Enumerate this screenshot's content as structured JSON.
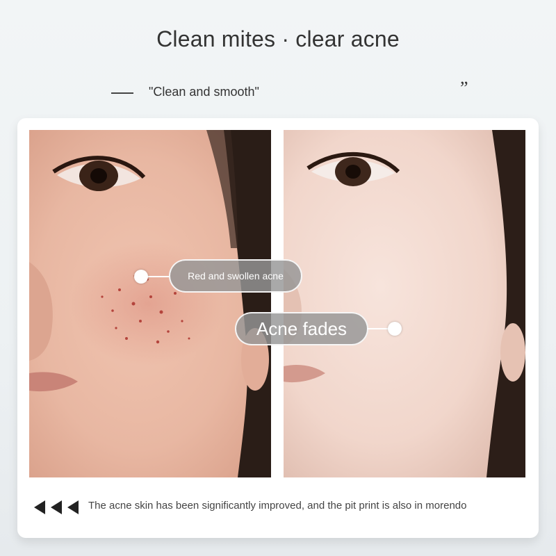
{
  "header": {
    "title": "Clean mites · clear acne",
    "subtitle": "\"Clean and smooth\"",
    "quote_mark": "”"
  },
  "labels": {
    "before_label": "Red and swollen acne",
    "after_label": "Acne fades"
  },
  "footer": {
    "caption": "The acne skin has been significantly improved, and the pit print is also in morendo",
    "arrow_icons": [
      "triangle-left-icon",
      "triangle-left-icon",
      "triangle-left-icon"
    ]
  },
  "colors": {
    "background": "#edf1f3",
    "card": "#ffffff",
    "label_bg": "#969696",
    "text": "#333333"
  }
}
